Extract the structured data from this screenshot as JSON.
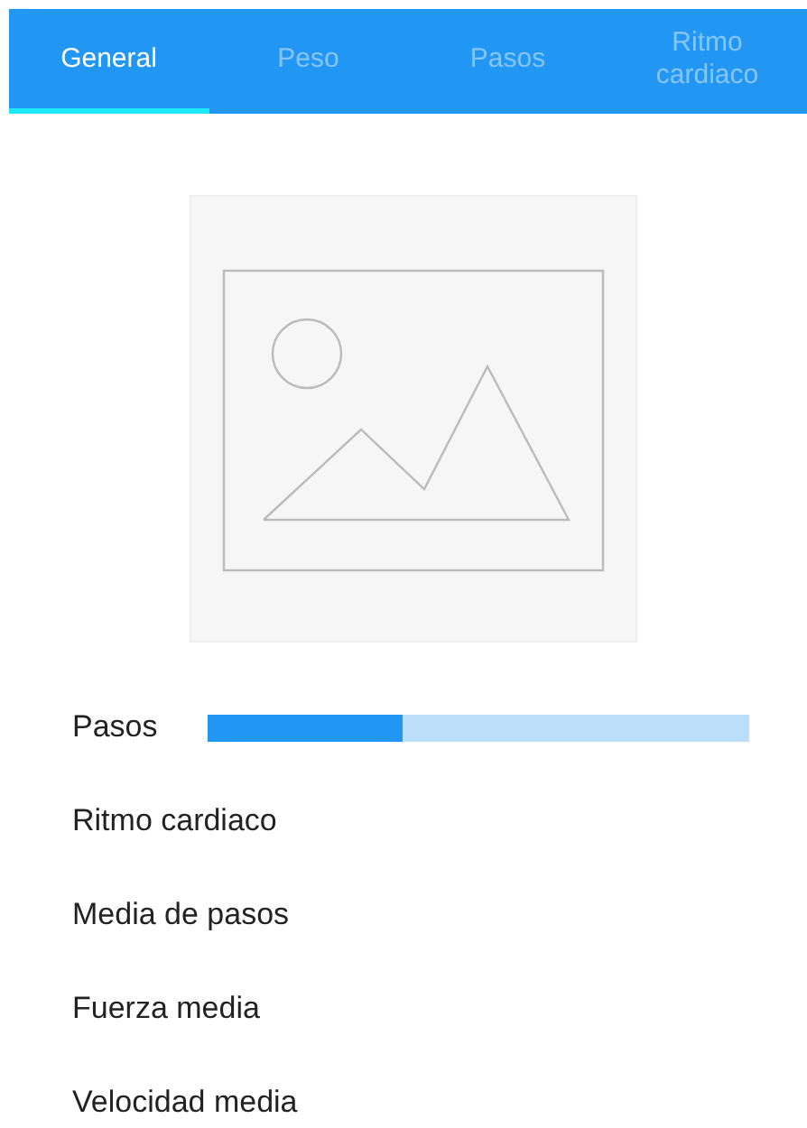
{
  "tabs": [
    {
      "label": "General",
      "selected": true
    },
    {
      "label": "Peso",
      "selected": false
    },
    {
      "label": "Pasos",
      "selected": false
    },
    {
      "label": "Ritmo cardiaco",
      "selected": false
    }
  ],
  "image": {
    "kind": "placeholder"
  },
  "stats": [
    {
      "kind": "bar",
      "label": "Pasos",
      "level": 0.36
    },
    {
      "kind": "label",
      "label": "Ritmo cardiaco"
    },
    {
      "kind": "label",
      "label": "Media de pasos"
    },
    {
      "kind": "label",
      "label": "Fuerza media"
    },
    {
      "kind": "label",
      "label": "Velocidad media"
    }
  ]
}
